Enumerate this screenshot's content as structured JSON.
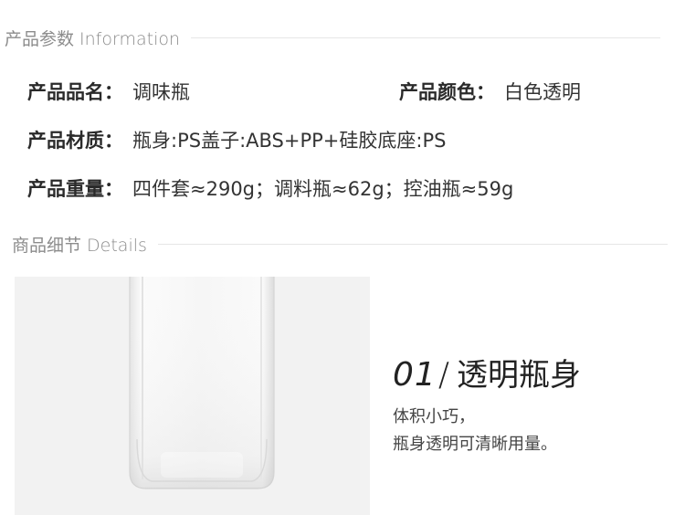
{
  "info_section": {
    "title": "产品参数 Information"
  },
  "specs": {
    "name_label": "产品品名：",
    "name_value": "调味瓶",
    "color_label": "产品颜色：",
    "color_value": "白色透明",
    "material_label": "产品材质：",
    "material_value": "瓶身:PS盖子:ABS+PP+硅胶底座:PS",
    "weight_label": "产品重量：",
    "weight_value": "四件套≈290g；调料瓶≈62g；控油瓶≈59g"
  },
  "details_section": {
    "title": "商品细节 Details"
  },
  "detail": {
    "number": "01",
    "slash": "/",
    "heading": "透明瓶身",
    "line1": "体积小巧，",
    "line2": "瓶身透明可清晰用量。"
  },
  "colors": {
    "section_title": "#8c8c8c",
    "photo_bg": "#f2f2f2"
  }
}
